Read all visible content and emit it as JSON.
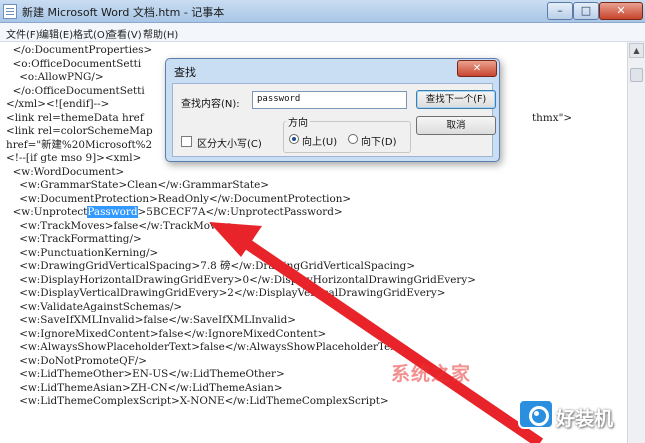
{
  "window": {
    "title": "新建 Microsoft Word 文档.htm - 记事本",
    "minimize_glyph": "–",
    "maximize_glyph": "□",
    "close_glyph": "✕"
  },
  "menu": [
    "文件(F)",
    "编辑(E)",
    "格式(O)",
    "查看(V)",
    "帮助(H)"
  ],
  "editor": {
    "highlight_before": "  <w:Unprotect",
    "highlight": "Password",
    "highlight_after": ">5BCECF7A</w:UnprotectPassword>",
    "lines": [
      "  </o:DocumentProperties>",
      "  <o:OfficeDocumentSetti",
      "    <o:AllowPNG/>",
      "  </o:OfficeDocumentSetti",
      "</xml><![endif]-->",
      "<link rel=themeData href",
      "<link rel=colorSchemeMap",
      "href=\"新建%20Microsoft%2",
      "<!--[if gte mso 9]><xml>",
      "  <w:WordDocument>",
      "    <w:GrammarState>Clean</w:GrammarState>",
      "    <w:DocumentProtection>ReadOnly</w:DocumentProtection>",
      "",
      "    <w:TrackMoves>false</w:TrackMoves>",
      "    <w:TrackFormatting/>",
      "    <w:PunctuationKerning/>",
      "    <w:DrawingGridVerticalSpacing>7.8 磅</w:DrawingGridVerticalSpacing>",
      "    <w:DisplayHorizontalDrawingGridEvery>0</w:DisplayHorizontalDrawingGridEvery>",
      "    <w:DisplayVerticalDrawingGridEvery>2</w:DisplayVerticalDrawingGridEvery>",
      "    <w:ValidateAgainstSchemas/>",
      "    <w:SaveIfXMLInvalid>false</w:SaveIfXMLInvalid>",
      "    <w:IgnoreMixedContent>false</w:IgnoreMixedContent>",
      "    <w:AlwaysShowPlaceholderText>false</w:AlwaysShowPlaceholderText>",
      "    <w:DoNotPromoteQF/>",
      "    <w:LidThemeOther>EN-US</w:LidThemeOther>",
      "    <w:LidThemeAsian>ZH-CN</w:LidThemeAsian>",
      "    <w:LidThemeComplexScript>X-NONE</w:LidThemeComplexScript>"
    ],
    "overflow_right_1": "thmx\">"
  },
  "find_dialog": {
    "title": "查找",
    "close_glyph": "✕",
    "find_label": "查找内容(N):",
    "find_value": "password",
    "find_next_label": "查找下一个(F)",
    "cancel_label": "取消",
    "match_case_label": "区分大小写(C)",
    "match_case_checked": false,
    "direction_label": "方向",
    "up_label": "向上(U)",
    "down_label": "向下(D)",
    "direction_selected": "up"
  },
  "colors": {
    "annotation_arrow": "#e8242a",
    "selection": "#3399ff"
  },
  "watermarks": {
    "pink": "系统之家",
    "brand": "好装机"
  }
}
